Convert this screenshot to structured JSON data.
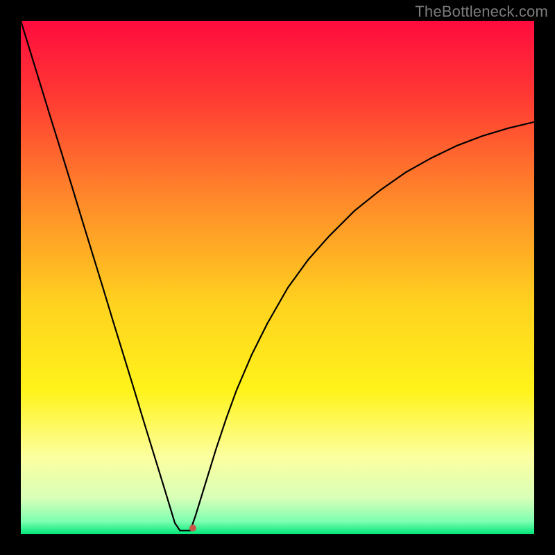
{
  "watermark": "TheBottleneck.com",
  "chart_data": {
    "type": "line",
    "title": "",
    "xlabel": "",
    "ylabel": "",
    "xlim": [
      0,
      100
    ],
    "ylim": [
      0,
      100
    ],
    "grid": false,
    "legend": false,
    "background_gradient": {
      "type": "vertical",
      "stops": [
        {
          "pos": 0.0,
          "color": "#ff0b3e"
        },
        {
          "pos": 0.15,
          "color": "#ff3a33"
        },
        {
          "pos": 0.35,
          "color": "#ff8a2a"
        },
        {
          "pos": 0.55,
          "color": "#ffd21f"
        },
        {
          "pos": 0.72,
          "color": "#fff31a"
        },
        {
          "pos": 0.85,
          "color": "#fcffa0"
        },
        {
          "pos": 0.93,
          "color": "#d8ffb8"
        },
        {
          "pos": 0.975,
          "color": "#7effb0"
        },
        {
          "pos": 1.0,
          "color": "#00e679"
        }
      ]
    },
    "series": [
      {
        "name": "bottleneck-curve",
        "stroke": "#000000",
        "stroke_width": 2.2,
        "x": [
          0.0,
          2.0,
          4.0,
          6.0,
          8.0,
          10.0,
          12.0,
          14.0,
          16.0,
          18.0,
          20.0,
          22.0,
          24.0,
          26.0,
          28.0,
          30.0,
          31.0,
          32.0,
          33.0,
          34.0,
          36.0,
          38.0,
          40.0,
          42.0,
          45.0,
          48.0,
          52.0,
          56.0,
          60.0,
          65.0,
          70.0,
          75.0,
          80.0,
          85.0,
          90.0,
          95.0,
          100.0
        ],
        "y": [
          100.0,
          93.5,
          87.0,
          80.5,
          74.1,
          67.6,
          61.0,
          54.5,
          48.0,
          41.4,
          34.9,
          28.4,
          21.8,
          15.3,
          8.8,
          2.2,
          0.7,
          0.7,
          0.7,
          3.5,
          10.0,
          16.5,
          22.5,
          28.0,
          35.0,
          41.0,
          48.0,
          53.5,
          58.0,
          63.0,
          67.0,
          70.5,
          73.3,
          75.7,
          77.6,
          79.1,
          80.3
        ]
      }
    ],
    "markers": [
      {
        "name": "optimum-dot",
        "x": 33.5,
        "y": 1.2,
        "r": 5,
        "fill": "#c65a4a"
      }
    ]
  }
}
